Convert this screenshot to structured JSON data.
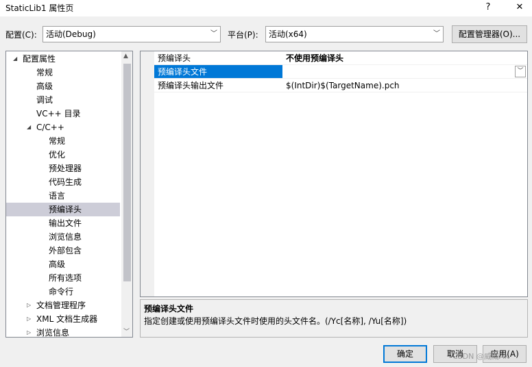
{
  "window": {
    "title": "StaticLib1 属性页",
    "help_glyph": "?",
    "close_glyph": "✕"
  },
  "toolbar": {
    "config_label": "配置(C):",
    "config_value": "活动(Debug)",
    "platform_label": "平台(P):",
    "platform_value": "活动(x64)",
    "config_manager_label": "配置管理器(O)..."
  },
  "tree": {
    "items": [
      {
        "label": "配置属性",
        "expander": "◢",
        "selected": false
      },
      {
        "label": "常规",
        "expander": "",
        "selected": false
      },
      {
        "label": "高级",
        "expander": "",
        "selected": false
      },
      {
        "label": "调试",
        "expander": "",
        "selected": false
      },
      {
        "label": "VC++ 目录",
        "expander": "",
        "selected": false
      },
      {
        "label": "C/C++",
        "expander": "◢",
        "selected": false
      },
      {
        "label": "常规",
        "expander": "",
        "selected": false
      },
      {
        "label": "优化",
        "expander": "",
        "selected": false
      },
      {
        "label": "预处理器",
        "expander": "",
        "selected": false
      },
      {
        "label": "代码生成",
        "expander": "",
        "selected": false
      },
      {
        "label": "语言",
        "expander": "",
        "selected": false
      },
      {
        "label": "预编译头",
        "expander": "",
        "selected": true
      },
      {
        "label": "输出文件",
        "expander": "",
        "selected": false
      },
      {
        "label": "浏览信息",
        "expander": "",
        "selected": false
      },
      {
        "label": "外部包含",
        "expander": "",
        "selected": false
      },
      {
        "label": "高级",
        "expander": "",
        "selected": false
      },
      {
        "label": "所有选项",
        "expander": "",
        "selected": false
      },
      {
        "label": "命令行",
        "expander": "",
        "selected": false
      },
      {
        "label": "文档管理程序",
        "expander": "▷",
        "selected": false
      },
      {
        "label": "XML 文档生成器",
        "expander": "▷",
        "selected": false
      },
      {
        "label": "浏览信息",
        "expander": "▷",
        "selected": false
      }
    ]
  },
  "grid": {
    "rows": [
      {
        "name": "预编译头",
        "value": "不使用预编译头",
        "bold": true,
        "selected": false
      },
      {
        "name": "预编译头文件",
        "value": "",
        "bold": false,
        "selected": true
      },
      {
        "name": "预编译头输出文件",
        "value": "$(IntDir)$(TargetName).pch",
        "bold": false,
        "selected": false
      }
    ]
  },
  "description": {
    "title": "预编译头文件",
    "text": "指定创建或使用预编译头文件时使用的头文件名。(/Yc[名称], /Yu[名称])"
  },
  "buttons": {
    "ok": "确定",
    "cancel": "取消",
    "apply": "应用(A)"
  },
  "watermark": "CSDN @威威AK",
  "icons": {
    "dropdown": "chevron-down-icon",
    "scroll_up": "triangle-up-icon",
    "scroll_down": "chevron-down-icon"
  },
  "colors": {
    "selection_blue": "#0078d7",
    "tree_selected": "#cdcdd8"
  }
}
